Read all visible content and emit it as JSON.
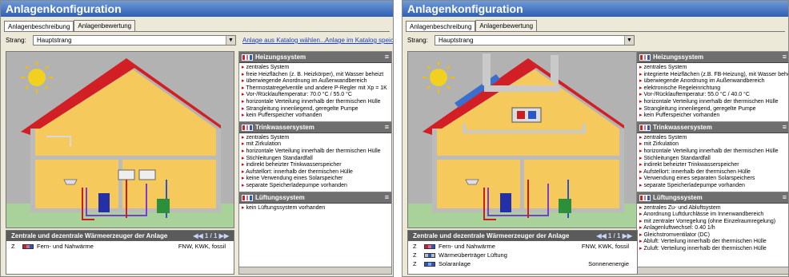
{
  "panels": [
    {
      "title": "Anlagenkonfiguration",
      "tabs": [
        "Anlagenbeschreibung",
        "Anlagenbewertung"
      ],
      "strang_label": "Strang:",
      "strang_value": "Hauptstrang",
      "links": [
        "Anlage aus Katalog wählen...",
        "Anlage im Katalog speichern..."
      ],
      "sections": [
        {
          "title": "Heizungssystem",
          "items": [
            "zentrales System",
            "freie Heizflächen (z. B. Heizkörper), mit Wasser beheizt",
            "überwiegende Anordnung im Außenwandbereich",
            "Thermostatregelventile und andere P-Regler mit Xp = 1K",
            "Vor-/Rücklauftemperatur: 70.0 °C / 55.0 °C",
            "horizontale Verteilung innerhalb der thermischen Hülle",
            "Strangleitung innenliegend, geregelte Pumpe",
            "kein Pufferspeicher vorhanden"
          ]
        },
        {
          "title": "Trinkwassersystem",
          "items": [
            "zentrales System",
            "mit Zirkulation",
            "horizontale Verteilung innerhalb der thermischen Hülle",
            "Stichleitungen Standardfall",
            "indirekt beheizter Trinkwasserspeicher",
            "Aufstellort: innerhalb der thermischen Hülle",
            "keine Verwendung eines Solarspeicher",
            "separate Speicherladepumpe vorhanden"
          ]
        },
        {
          "title": "Lüftungssystem",
          "items": [
            "kein Lüftungssystem vorhanden"
          ]
        }
      ],
      "bottom": {
        "title": "Zentrale und dezentrale Wärmeerzeuger der Anlage",
        "pager": "◀◀ 1 / 1 ▶▶",
        "rows": [
          {
            "z": "Z",
            "name": "Fern- und Nahwärme",
            "type": "FNW, KWK, fossil"
          }
        ]
      }
    },
    {
      "title": "Anlagenkonfiguration",
      "tabs": [
        "Anlagenbeschreibung",
        "Anlagenbewertung"
      ],
      "strang_label": "Strang:",
      "strang_value": "Hauptstrang",
      "links": [],
      "sections": [
        {
          "title": "Heizungssystem",
          "items": [
            "zentrales System",
            "integrierte Heizflächen (z.B. FB-Heizung), mit Wasser beheizt",
            "überwiegende Anordnung im Außenwandbereich",
            "elektronische Regeleinrichtung",
            "Vor-/Rücklauftemperatur: 55.0 °C / 40.0 °C",
            "horizontale Verteilung innerhalb der thermischen Hülle",
            "Strangleitung innenliegend, geregelte Pumpe",
            "kein Pufferspeicher vorhanden"
          ]
        },
        {
          "title": "Trinkwassersystem",
          "items": [
            "zentrales System",
            "mit Zirkulation",
            "horizontale Verteilung innerhalb der thermischen Hülle",
            "Stichleitungen Standardfall",
            "indirekt beheizter Trinkwasserspeicher",
            "Aufstellort: innerhalb der thermischen Hülle",
            "Verwendung eines separaten Solarspeichers",
            "separate Speicherladepumpe vorhanden"
          ]
        },
        {
          "title": "Lüftungssystem",
          "items": [
            "zentrales Zu- und Abluftsystem",
            "Anordnung Luftdurchlässe im Innenwandbereich",
            "mit zentraler Vorregelung (ohne Einzelraumregelung)",
            "Anlagenluftwechsel: 0.40 1/h",
            "Gleichstromventilator (DC)",
            "Abluft: Verteilung innerhalb der thermischen Hülle",
            "Zuluft: Verteilung innerhalb der thermischen Hülle"
          ]
        }
      ],
      "bottom": {
        "title": "Zentrale und dezentrale Wärmeerzeuger der Anlage",
        "pager": "◀◀ 1 / 1 ▶▶",
        "rows": [
          {
            "z": "Z",
            "name": "Fern- und Nahwärme",
            "type": "FNW, KWK, fossil"
          },
          {
            "z": "Z",
            "name": "Wärmeüberträger Lüftung",
            "type": ""
          },
          {
            "z": "Z",
            "name": "Solaranlage",
            "type": "Sonnenenergie"
          }
        ]
      }
    }
  ]
}
